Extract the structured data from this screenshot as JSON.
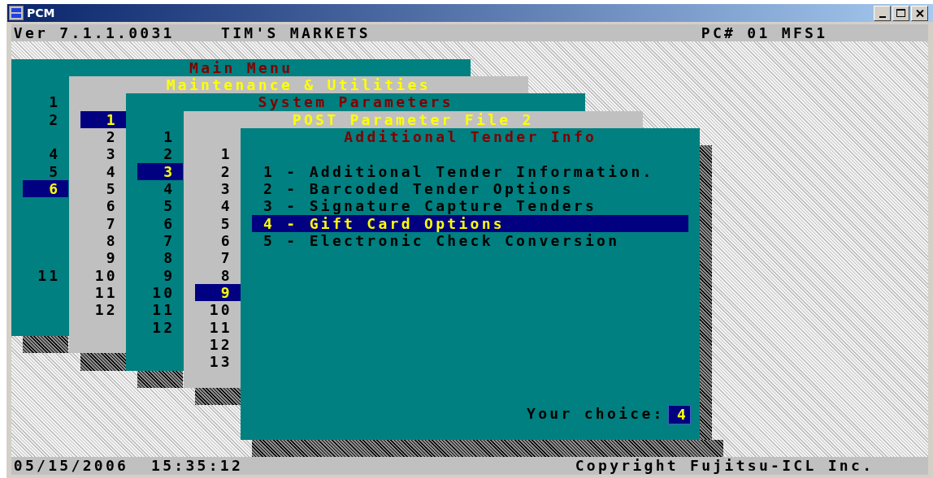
{
  "window": {
    "title": "PCM"
  },
  "header": {
    "version": "Ver 7.1.1.0031",
    "store": "TIM'S MARKETS",
    "terminal": "PC# 01 MFS1"
  },
  "menus": [
    {
      "title": "Main Menu",
      "items": [
        {
          "label": "1",
          "selected": false
        },
        {
          "label": "2",
          "selected": false
        },
        {
          "label": "4",
          "selected": false
        },
        {
          "label": "5",
          "selected": false
        },
        {
          "label": "6",
          "selected": true
        },
        {
          "label": "11",
          "selected": false
        }
      ]
    },
    {
      "title": "Maintenance & Utilities",
      "items": [
        {
          "label": "1",
          "selected": true
        },
        {
          "label": "2",
          "selected": false
        },
        {
          "label": "3",
          "selected": false
        },
        {
          "label": "4",
          "selected": false
        },
        {
          "label": "5",
          "selected": false
        },
        {
          "label": "6",
          "selected": false
        },
        {
          "label": "7",
          "selected": false
        },
        {
          "label": "8",
          "selected": false
        },
        {
          "label": "9",
          "selected": false
        },
        {
          "label": "10",
          "selected": false
        },
        {
          "label": "11",
          "selected": false
        },
        {
          "label": "12",
          "selected": false
        }
      ]
    },
    {
      "title": "System Parameters",
      "items": [
        {
          "label": "1",
          "selected": false
        },
        {
          "label": "2",
          "selected": false
        },
        {
          "label": "3",
          "selected": true
        },
        {
          "label": "4",
          "selected": false
        },
        {
          "label": "5",
          "selected": false
        },
        {
          "label": "6",
          "selected": false
        },
        {
          "label": "7",
          "selected": false
        },
        {
          "label": "8",
          "selected": false
        },
        {
          "label": "9",
          "selected": false
        },
        {
          "label": "10",
          "selected": false
        },
        {
          "label": "11",
          "selected": false
        },
        {
          "label": "12",
          "selected": false
        }
      ]
    },
    {
      "title": "POST Parameter File 2",
      "items": [
        {
          "label": "1",
          "selected": false
        },
        {
          "label": "2",
          "selected": false
        },
        {
          "label": "3",
          "selected": false
        },
        {
          "label": "4",
          "selected": false
        },
        {
          "label": "5",
          "selected": false
        },
        {
          "label": "6",
          "selected": false
        },
        {
          "label": "7",
          "selected": false
        },
        {
          "label": "8",
          "selected": false
        },
        {
          "label": "9",
          "selected": true
        },
        {
          "label": "10",
          "selected": false
        },
        {
          "label": "11",
          "selected": false
        },
        {
          "label": "12",
          "selected": false
        },
        {
          "label": "13",
          "selected": false
        }
      ]
    },
    {
      "title": "Additional Tender Info",
      "items": [
        {
          "label": "1 - Additional Tender Information.",
          "selected": false
        },
        {
          "label": "2 - Barcoded Tender Options",
          "selected": false
        },
        {
          "label": "3 - Signature Capture Tenders",
          "selected": false
        },
        {
          "label": "4 - Gift Card Options",
          "selected": true
        },
        {
          "label": "5 - Electronic Check Conversion",
          "selected": false
        }
      ],
      "prompt": {
        "label": "Your choice:",
        "value": "4"
      }
    }
  ],
  "status_bar": {
    "date": "05/15/2006",
    "time": "15:35:12",
    "copyright": "Copyright Fujitsu-ICL Inc."
  }
}
